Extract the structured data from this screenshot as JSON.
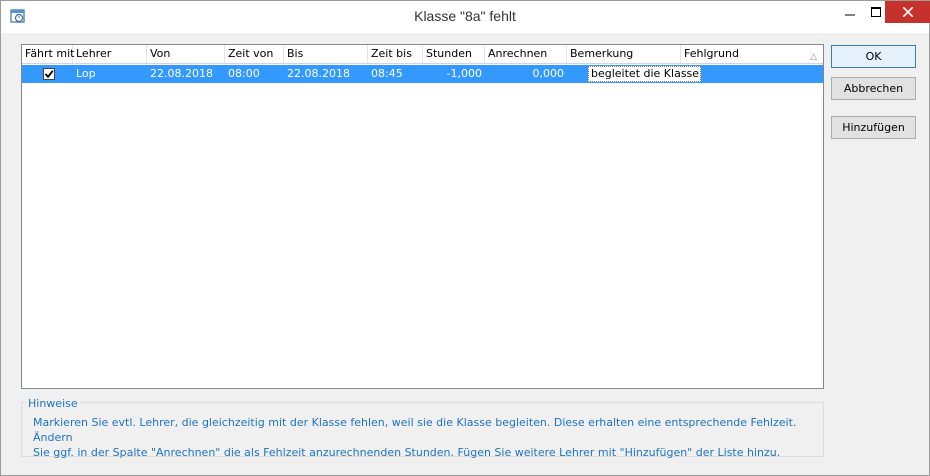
{
  "window": {
    "title": "Klasse \"8a\" fehlt"
  },
  "grid": {
    "columns": [
      "Fährt mit",
      "Lehrer",
      "Von",
      "Zeit von",
      "Bis",
      "Zeit bis",
      "Stunden",
      "Anrechnen",
      "Bemerkung",
      "Fehlgrund"
    ],
    "rows": [
      {
        "faehrt_mit": true,
        "lehrer": "Lop",
        "von": "22.08.2018",
        "zeit_von": "08:00",
        "bis": "22.08.2018",
        "zeit_bis": "08:45",
        "stunden": "-1,000",
        "anrechnen": "0,000",
        "bemerkung": "begleitet die Klasse",
        "fehlgrund": ""
      }
    ]
  },
  "buttons": {
    "ok": "OK",
    "abbrechen": "Abbrechen",
    "hinzufuegen": "Hinzufügen"
  },
  "hints": {
    "title": "Hinweise",
    "line1": "Markieren Sie evtl. Lehrer, die gleichzeitig mit der Klasse fehlen, weil sie die Klasse begleiten. Diese erhalten eine entsprechende Fehlzeit. Ändern",
    "line2": "Sie ggf. in der Spalte \"Anrechnen\" die als Fehlzeit anzurechnenden Stunden. Fügen Sie weitere Lehrer mit \"Hinzufügen\" der Liste hinzu."
  },
  "colors": {
    "selection": "#3399ff",
    "hint_text": "#1e73be",
    "close_button": "#c7312b"
  }
}
